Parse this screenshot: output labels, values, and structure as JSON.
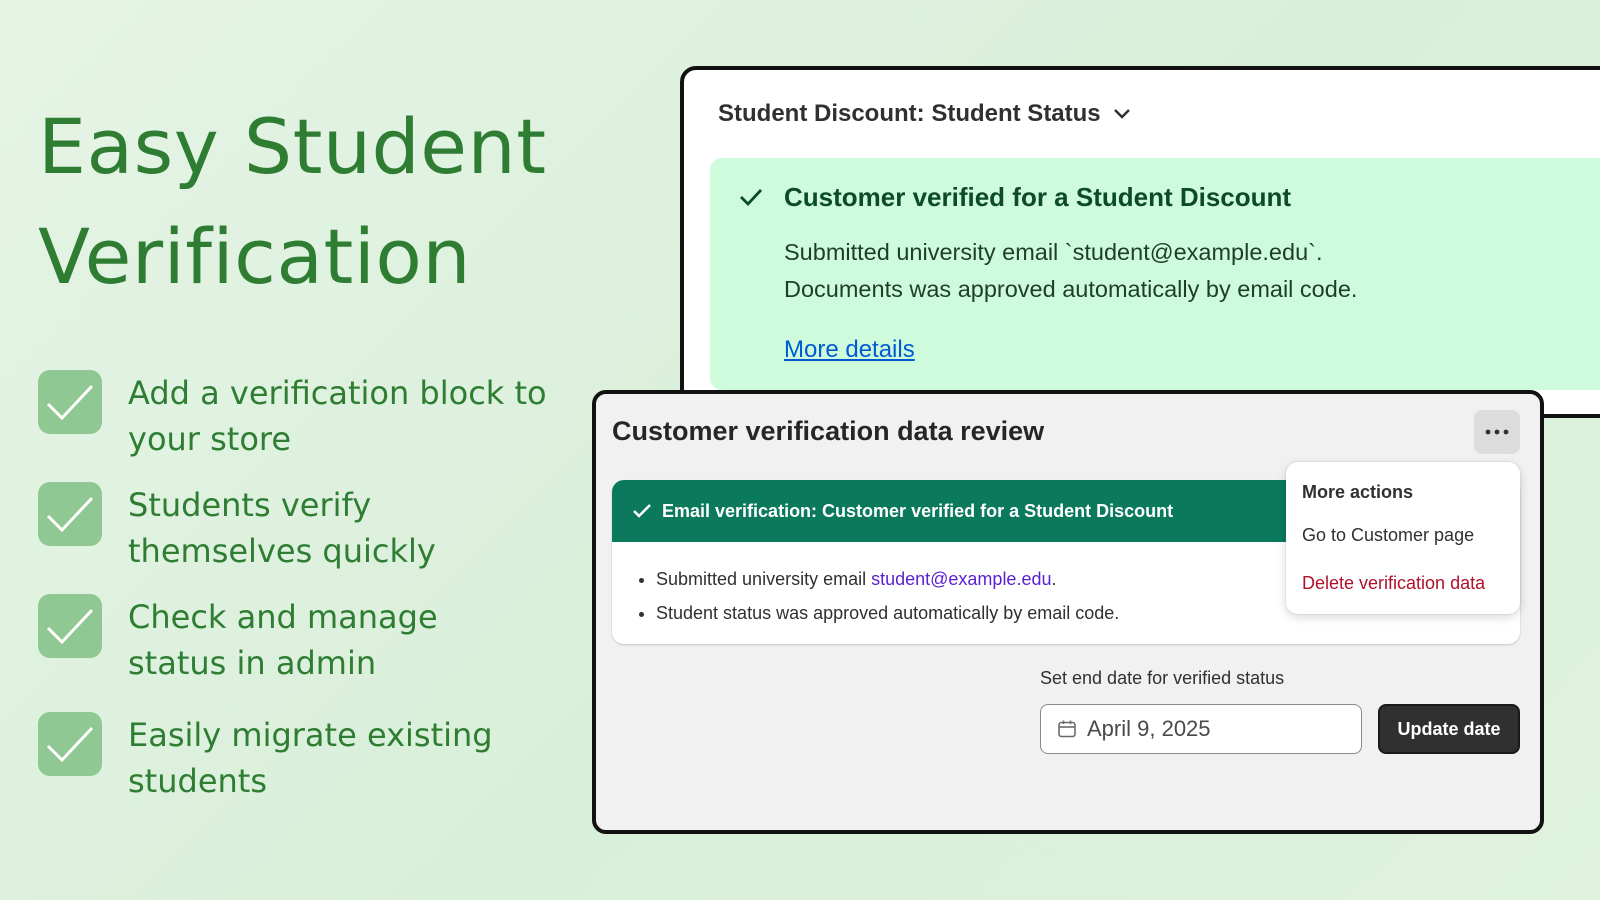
{
  "headline": {
    "line1": "Easy Student",
    "line2": "Verification"
  },
  "features": [
    {
      "line1": "Add a verification block to",
      "line2": "your store"
    },
    {
      "line1": "Students verify",
      "line2": "themselves quickly"
    },
    {
      "line1": "Check and manage",
      "line2": "status in admin"
    },
    {
      "line1": "Easily migrate existing",
      "line2": "students"
    }
  ],
  "back_card": {
    "title": "Student Discount: Student Status",
    "panel_heading": "Customer verified for a Student Discount",
    "body_line1": "Submitted university email `student@example.edu`.",
    "body_line2": "Documents was approved automatically by email code.",
    "link": "More details"
  },
  "front_card": {
    "title": "Customer verification data review",
    "verification_header": "Email verification: Customer verified for a Student Discount",
    "bullet1_prefix": "Submitted university email ",
    "bullet1_email": "student@example.edu",
    "bullet1_suffix": ".",
    "bullet2": "Student status was approved automatically by email code.",
    "menu": {
      "title": "More actions",
      "go_customer": "Go to Customer page",
      "delete": "Delete verification data"
    },
    "date_label": "Set end date for verified status",
    "date_value": "April 9, 2025",
    "update_button": "Update date"
  },
  "colors": {
    "brand_green": "#2e7d32",
    "header_green": "#0b7a5c",
    "success_bg": "#cdfbdb",
    "link_blue": "#005bd3",
    "danger_red": "#b0102a"
  },
  "icons": [
    "checkmark-icon",
    "chevron-down-icon",
    "ellipsis-icon",
    "calendar-icon"
  ]
}
